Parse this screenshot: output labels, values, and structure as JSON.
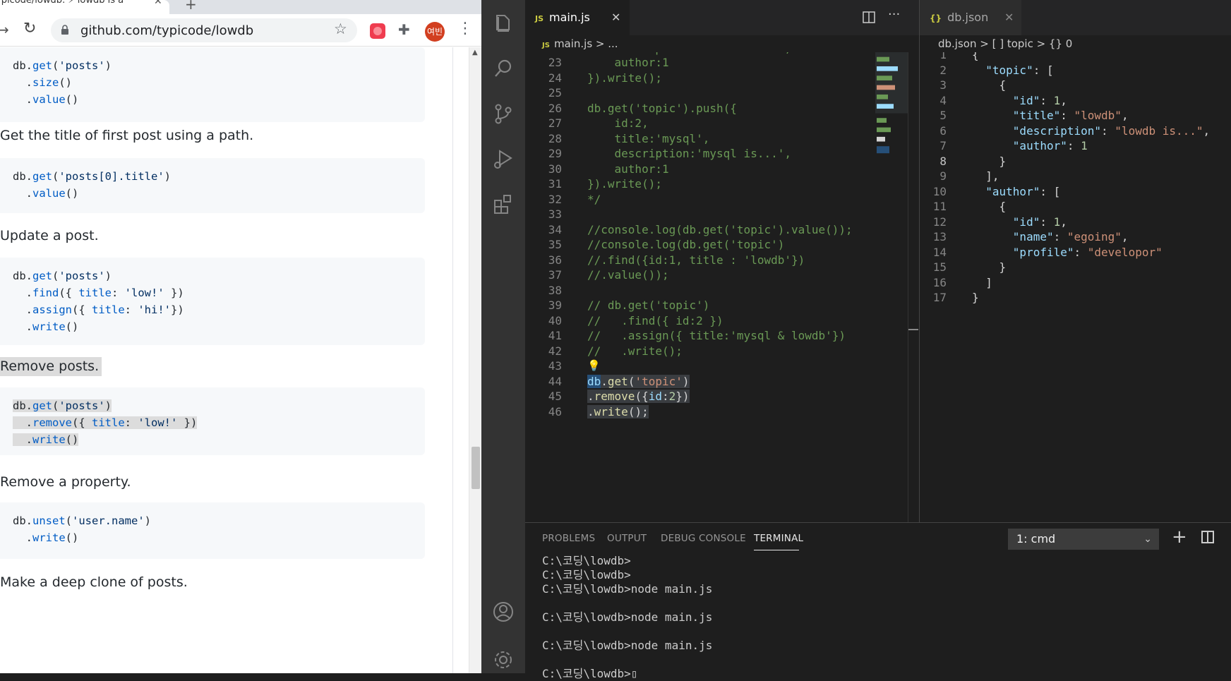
{
  "browser": {
    "tab_title": "ypicode/lowdb: ⚡ lowdb is a",
    "url": "github.com/typicode/lowdb",
    "avatar_text": "여빈",
    "accent_colors": {
      "avatar": "#d23f20",
      "extension": "#ef3c4f"
    },
    "blocks": [
      {
        "kind": "code",
        "lines": [
          "db.get('posts')",
          "  .size()",
          "  .value()"
        ]
      },
      {
        "kind": "text",
        "text": "Get the title of first post using a path."
      },
      {
        "kind": "code",
        "lines": [
          "db.get('posts[0].title')",
          "  .value()"
        ]
      },
      {
        "kind": "text",
        "text": "Update a post."
      },
      {
        "kind": "code",
        "lines": [
          "db.get('posts')",
          "  .find({ title: 'low!' })",
          "  .assign({ title: 'hi!'})",
          "  .write()"
        ]
      },
      {
        "kind": "text",
        "text": "Remove posts.",
        "selected": true
      },
      {
        "kind": "code",
        "lines": [
          "db.get('posts')",
          "  .remove({ title: 'low!' })",
          "  .write()"
        ],
        "selected": true
      },
      {
        "kind": "text",
        "text": "Remove a property."
      },
      {
        "kind": "code",
        "lines": [
          "db.unset('user.name')",
          "  .write()"
        ]
      },
      {
        "kind": "text",
        "text": "Make a deep clone of posts."
      }
    ]
  },
  "vscode": {
    "left_editor": {
      "tab_label": "main.js",
      "tab_lang": "JS",
      "breadcrumb": "main.js > ...",
      "top_partial": "description:'lowdb is...',",
      "lines": [
        {
          "n": "23",
          "text": "    author:1"
        },
        {
          "n": "24",
          "text": "}).write();"
        },
        {
          "n": "25",
          "text": ""
        },
        {
          "n": "26",
          "text": "db.get('topic').push({"
        },
        {
          "n": "27",
          "text": "    id:2,"
        },
        {
          "n": "28",
          "text": "    title:'mysql',"
        },
        {
          "n": "29",
          "text": "    description:'mysql is...',"
        },
        {
          "n": "30",
          "text": "    author:1"
        },
        {
          "n": "31",
          "text": "}).write();"
        },
        {
          "n": "32",
          "text": "*/"
        },
        {
          "n": "33",
          "text": ""
        },
        {
          "n": "34",
          "text": "//console.log(db.get('topic').value());"
        },
        {
          "n": "35",
          "text": "//console.log(db.get('topic')"
        },
        {
          "n": "36",
          "text": "//.find({id:1, title : 'lowdb'})"
        },
        {
          "n": "37",
          "text": "//.value());"
        },
        {
          "n": "38",
          "text": ""
        },
        {
          "n": "39",
          "text": "// db.get('topic')"
        },
        {
          "n": "40",
          "text": "//   .find({ id:2 })"
        },
        {
          "n": "41",
          "text": "//   .assign({ title:'mysql & lowdb'})"
        },
        {
          "n": "42",
          "text": "//   .write();"
        },
        {
          "n": "43",
          "text": ""
        },
        {
          "n": "44",
          "text": "db.get('topic')"
        },
        {
          "n": "45",
          "text": ".remove({id:2})"
        },
        {
          "n": "46",
          "text": ".write();"
        }
      ]
    },
    "right_editor": {
      "tab_label": "db.json",
      "tab_lang": "{}",
      "breadcrumb": "db.json > [ ] topic > {} 0",
      "lines": [
        {
          "n": "1",
          "text": "{"
        },
        {
          "n": "2",
          "text": "  \"topic\": ["
        },
        {
          "n": "3",
          "text": "    {"
        },
        {
          "n": "4",
          "text": "      \"id\": 1,"
        },
        {
          "n": "5",
          "text": "      \"title\": \"lowdb\","
        },
        {
          "n": "6",
          "text": "      \"description\": \"lowdb is...\","
        },
        {
          "n": "7",
          "text": "      \"author\": 1"
        },
        {
          "n": "8",
          "text": "    }"
        },
        {
          "n": "9",
          "text": "  ],"
        },
        {
          "n": "10",
          "text": "  \"author\": ["
        },
        {
          "n": "11",
          "text": "    {"
        },
        {
          "n": "12",
          "text": "      \"id\": 1,"
        },
        {
          "n": "13",
          "text": "      \"name\": \"egoing\","
        },
        {
          "n": "14",
          "text": "      \"profile\": \"developor\""
        },
        {
          "n": "15",
          "text": "    }"
        },
        {
          "n": "16",
          "text": "  ]"
        },
        {
          "n": "17",
          "text": "}"
        }
      ]
    },
    "panel": {
      "tabs": [
        "PROBLEMS",
        "OUTPUT",
        "DEBUG CONSOLE",
        "TERMINAL"
      ],
      "terminal_select": "1: cmd",
      "terminal_lines": [
        "C:\\코딩\\lowdb>",
        "C:\\코딩\\lowdb>",
        "C:\\코딩\\lowdb>node main.js",
        "",
        "C:\\코딩\\lowdb>node main.js",
        "",
        "C:\\코딩\\lowdb>node main.js",
        "",
        "C:\\코딩\\lowdb>▯"
      ]
    }
  }
}
